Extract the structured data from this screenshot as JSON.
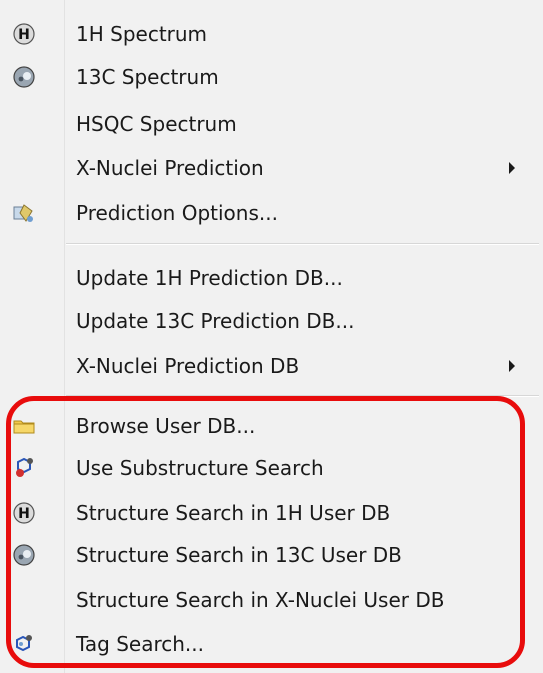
{
  "menu": {
    "items": [
      {
        "label": "1H Spectrum",
        "icon": "h-nucleus-icon"
      },
      {
        "label": "13C Spectrum",
        "icon": "c-nucleus-icon"
      },
      {
        "label": "HSQC Spectrum",
        "icon": ""
      },
      {
        "label": "X-Nuclei Prediction",
        "icon": "",
        "submenu": true
      },
      {
        "label": "Prediction Options...",
        "icon": "prediction-options-icon"
      },
      {
        "label": "Update 1H Prediction DB...",
        "icon": ""
      },
      {
        "label": "Update 13C Prediction DB...",
        "icon": ""
      },
      {
        "label": "X-Nuclei Prediction DB",
        "icon": "",
        "submenu": true
      },
      {
        "label": "Browse User DB...",
        "icon": "folder-icon"
      },
      {
        "label": "Use Substructure Search",
        "icon": "substructure-icon"
      },
      {
        "label": "Structure Search in 1H User DB",
        "icon": "h-nucleus-icon"
      },
      {
        "label": "Structure Search in 13C User DB",
        "icon": "c-nucleus-icon"
      },
      {
        "label": "Structure Search in X-Nuclei User DB",
        "icon": ""
      },
      {
        "label": "Tag Search...",
        "icon": "tag-search-icon"
      }
    ]
  },
  "colors": {
    "menu_bg": "#f1f1f1",
    "text": "#1a1a1a",
    "highlight": "#e80c0c"
  }
}
